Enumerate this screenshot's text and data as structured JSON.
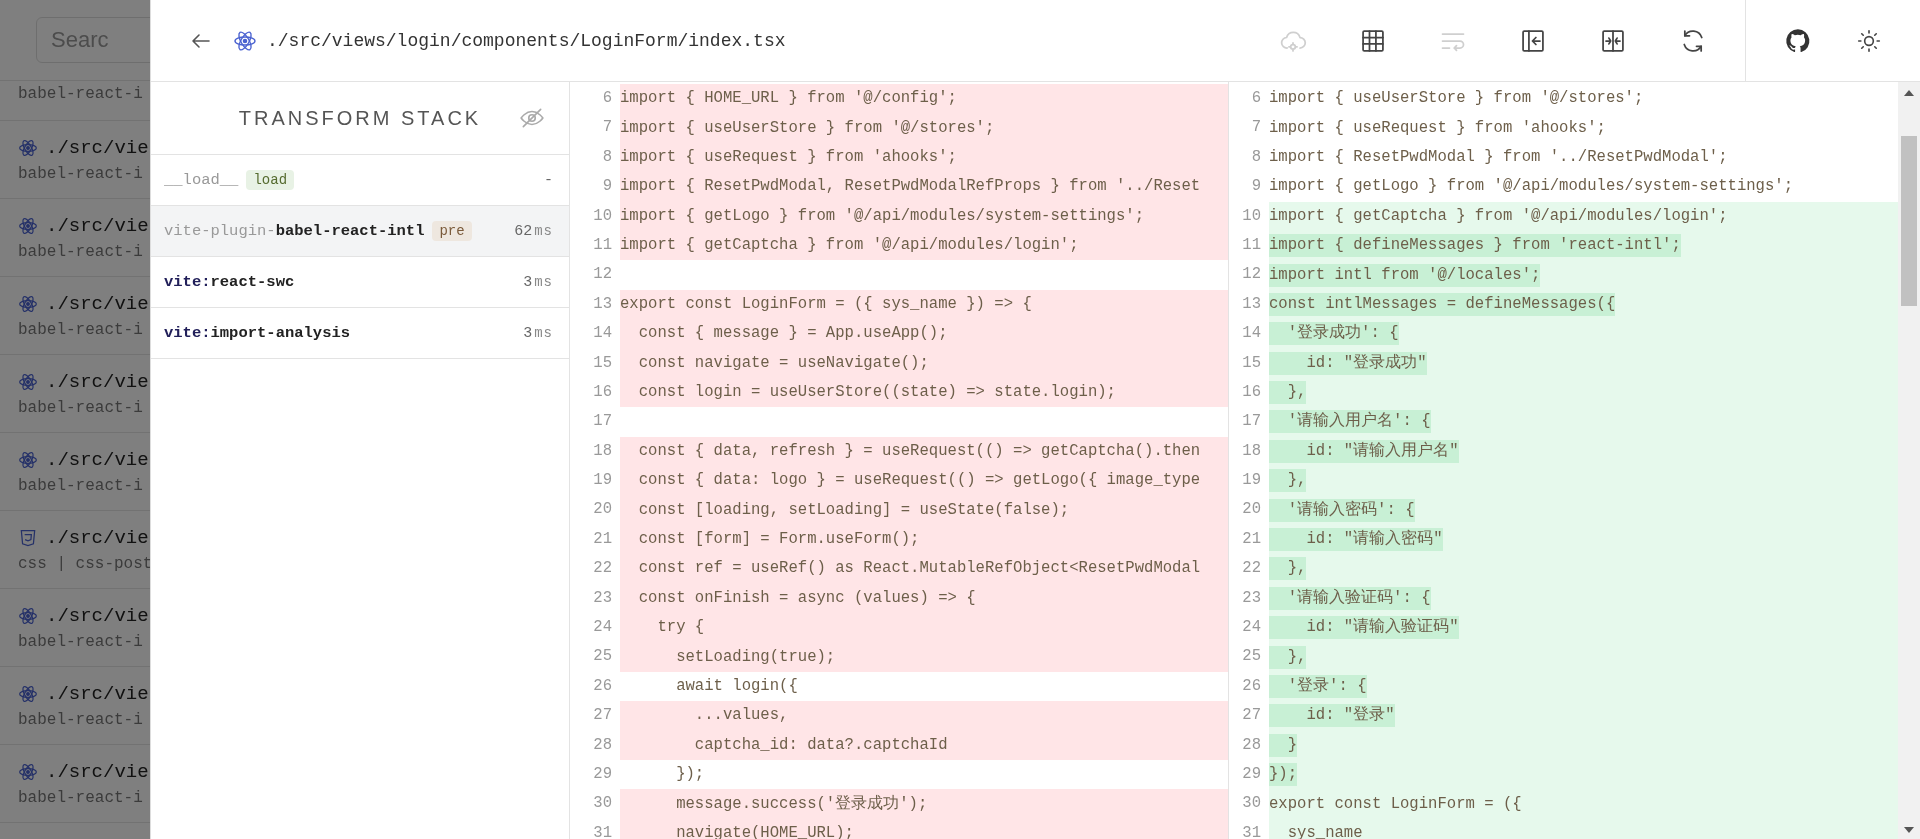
{
  "background_list": {
    "search_placeholder": "Searc",
    "items": [
      {
        "plugin": "babel-react-i"
      },
      {
        "kind": "react",
        "path": "./src/vie",
        "plugin": "babel-react-i"
      },
      {
        "kind": "react",
        "path": "./src/vie",
        "plugin": "babel-react-i"
      },
      {
        "kind": "react",
        "path": "./src/vie",
        "plugin": "babel-react-i"
      },
      {
        "kind": "react",
        "path": "./src/vie",
        "plugin": "babel-react-i"
      },
      {
        "kind": "react",
        "path": "./src/vie",
        "plugin": "babel-react-i"
      },
      {
        "kind": "css",
        "path": "./src/vie",
        "plugin": "css | css-post"
      },
      {
        "kind": "react",
        "path": "./src/vie",
        "plugin": "babel-react-i"
      },
      {
        "kind": "react",
        "path": "./src/vie",
        "plugin": "babel-react-i"
      },
      {
        "kind": "react",
        "path": "./src/vie",
        "plugin": "babel-react-i"
      }
    ]
  },
  "header": {
    "file_path": "./src/views/login/components/LoginForm/index.tsx",
    "toolbar": [
      {
        "kind": "cloud",
        "disabled": true
      },
      {
        "kind": "table",
        "disabled": false
      },
      {
        "kind": "wrap",
        "disabled": true
      },
      {
        "kind": "sidebar",
        "disabled": false
      },
      {
        "kind": "split",
        "disabled": false
      },
      {
        "kind": "refresh",
        "disabled": false
      }
    ],
    "extra": [
      {
        "kind": "github"
      },
      {
        "kind": "sun"
      }
    ]
  },
  "transform_stack": {
    "title": "TRANSFORM STACK",
    "rows": [
      {
        "prefix": "__load__",
        "prefix_muted": true,
        "badge": {
          "text": "load",
          "kind": "load"
        },
        "time": "-",
        "selected": false
      },
      {
        "prefix": "vite-plugin-",
        "prefix_muted": true,
        "name": "babel-react-intl",
        "badge": {
          "text": "pre",
          "kind": "pre"
        },
        "time": "62",
        "unit": "ms",
        "selected": true
      },
      {
        "prefix": "vite:",
        "prefix_muted": false,
        "name": "react-swc",
        "time": "3",
        "unit": "ms",
        "selected": false
      },
      {
        "prefix": "vite:",
        "prefix_muted": false,
        "name": "import-analysis",
        "time": "3",
        "unit": "ms",
        "selected": false
      }
    ]
  },
  "diff": {
    "left": [
      {
        "num": "6",
        "text": "import { HOME_URL } from '@/config';",
        "changed": true
      },
      {
        "num": "7",
        "text": "import { useUserStore } from '@/stores';",
        "changed": true
      },
      {
        "num": "8",
        "text": "import { useRequest } from 'ahooks';",
        "changed": true
      },
      {
        "num": "9",
        "text": "import { ResetPwdModal, ResetPwdModalRefProps } from '../Reset",
        "changed": true
      },
      {
        "num": "10",
        "text": "import { getLogo } from '@/api/modules/system-settings';",
        "changed": true
      },
      {
        "num": "11",
        "text": "import { getCaptcha } from '@/api/modules/login';",
        "changed": true
      },
      {
        "num": "12",
        "changed": false
      },
      {
        "num": "13",
        "text": "export const LoginForm = ({ sys_name }) => {",
        "changed": true
      },
      {
        "num": "14",
        "text": "  const { message } = App.useApp();",
        "changed": true
      },
      {
        "num": "15",
        "text": "  const navigate = useNavigate();",
        "changed": true
      },
      {
        "num": "16",
        "text": "  const login = useUserStore((state) => state.login);",
        "changed": true
      },
      {
        "num": "17",
        "changed": false
      },
      {
        "num": "18",
        "text": "  const { data, refresh } = useRequest(() => getCaptcha().then",
        "changed": true
      },
      {
        "num": "19",
        "text": "  const { data: logo } = useRequest(() => getLogo({ image_type",
        "changed": true
      },
      {
        "num": "20",
        "text": "  const [loading, setLoading] = useState(false);",
        "changed": true
      },
      {
        "num": "21",
        "text": "  const [form] = Form.useForm();",
        "changed": true
      },
      {
        "num": "22",
        "text": "  const ref = useRef() as React.MutableRefObject<ResetPwdModal",
        "changed": true
      },
      {
        "num": "23",
        "text": "  const onFinish = async (values) => {",
        "changed": true
      },
      {
        "num": "24",
        "text": "    try {",
        "changed": true
      },
      {
        "num": "25",
        "text": "      setLoading(true);",
        "changed": true
      },
      {
        "num": "26",
        "text": "      await login({",
        "changed": false
      },
      {
        "num": "27",
        "text": "        ...values,",
        "changed": true
      },
      {
        "num": "28",
        "text": "        captcha_id: data?.captchaId",
        "changed": true
      },
      {
        "num": "29",
        "text": "      });",
        "changed": false
      },
      {
        "num": "30",
        "text": "      message.success('登录成功');",
        "changed": true
      },
      {
        "num": "31",
        "text": "      navigate(HOME_URL);",
        "changed": true
      }
    ],
    "right": [
      {
        "num": "6",
        "text": "import { useUserStore } from '@/stores';",
        "changed": false
      },
      {
        "num": "7",
        "text": "import { useRequest } from 'ahooks';",
        "changed": false
      },
      {
        "num": "8",
        "text": "import { ResetPwdModal } from '../ResetPwdModal';",
        "changed": false
      },
      {
        "num": "9",
        "text": "import { getLogo } from '@/api/modules/system-settings';",
        "changed": false
      },
      {
        "num": "10",
        "text": "import { getCaptcha } from '@/api/modules/login';",
        "changed": true,
        "inline": false
      },
      {
        "num": "11",
        "text": "import { defineMessages } from 'react-intl';",
        "changed": true,
        "inline": true
      },
      {
        "num": "12",
        "text": "import intl from '@/locales';",
        "changed": true,
        "inline": true
      },
      {
        "num": "13",
        "text": "const intlMessages = defineMessages({",
        "changed": true,
        "inline": true
      },
      {
        "num": "14",
        "text": "  '登录成功': {",
        "changed": true,
        "inline": true
      },
      {
        "num": "15",
        "text": "    id: \"登录成功\"",
        "changed": true,
        "inline": true
      },
      {
        "num": "16",
        "text": "  },",
        "changed": true,
        "inline": true
      },
      {
        "num": "17",
        "text": "  '请输入用户名': {",
        "changed": true,
        "inline": true
      },
      {
        "num": "18",
        "text": "    id: \"请输入用户名\"",
        "changed": true,
        "inline": true
      },
      {
        "num": "19",
        "text": "  },",
        "changed": true,
        "inline": true
      },
      {
        "num": "20",
        "text": "  '请输入密码': {",
        "changed": true,
        "inline": true
      },
      {
        "num": "21",
        "text": "    id: \"请输入密码\"",
        "changed": true,
        "inline": true
      },
      {
        "num": "22",
        "text": "  },",
        "changed": true,
        "inline": true
      },
      {
        "num": "23",
        "text": "  '请输入验证码': {",
        "changed": true,
        "inline": true
      },
      {
        "num": "24",
        "text": "    id: \"请输入验证码\"",
        "changed": true,
        "inline": true
      },
      {
        "num": "25",
        "text": "  },",
        "changed": true,
        "inline": true
      },
      {
        "num": "26",
        "text": "  '登录': {",
        "changed": true,
        "inline": true
      },
      {
        "num": "27",
        "text": "    id: \"登录\"",
        "changed": true,
        "inline": true
      },
      {
        "num": "28",
        "text": "  }",
        "changed": true,
        "inline": true
      },
      {
        "num": "29",
        "text": "});",
        "changed": true,
        "inline": true
      },
      {
        "num": "30",
        "text": "export const LoginForm = ({",
        "changed": true,
        "inline": false
      },
      {
        "num": "31",
        "text": "  sys_name",
        "changed": true,
        "inline": false
      }
    ]
  }
}
